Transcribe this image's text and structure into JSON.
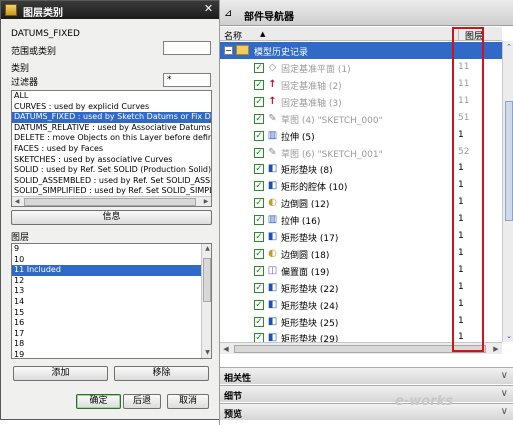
{
  "dialog": {
    "title": "图层类别",
    "close_glyph": "✕",
    "selected_category": "DATUMS_FIXED",
    "range_label": "范围或类别",
    "range_value": "",
    "category_label": "类别",
    "filter_label": "过滤器",
    "filter_value": "*",
    "category_list": [
      "ALL",
      "CURVES : used by explicid Curves",
      "DATUMS_FIXED : used by Sketch Datums or Fix Datums",
      "DATUMS_RELATIVE : used by Associative Datums",
      "DELETE : move Objects on this Layer before definitiv",
      "FACES : used by Faces",
      "SKETCHES : used by associative Curves",
      "SOLID : used by Ref. Set SOLID (Production Solid)",
      "SOLID_ASSEMBLED : used by Ref. Set SOLID_ASSEMBLED",
      "SOLID_SIMPLIFIED : used by Ref. Set SOLID_SIMPLIFIED"
    ],
    "selected_category_index": 2,
    "info_button": "信息",
    "layer_label": "图层",
    "layer_list": [
      "9",
      "10",
      "11 Included",
      "12",
      "13",
      "14",
      "15",
      "16",
      "17",
      "18",
      "19"
    ],
    "selected_layer_index": 2,
    "add_button": "添加",
    "remove_button": "移除",
    "ok_button": "确定",
    "back_button": "后退",
    "cancel_button": "取消"
  },
  "navigator": {
    "pin_glyph": "⊿",
    "title": "部件导航器",
    "col_name": "名称",
    "sort_glyph": "▲",
    "col_layer": "图层",
    "root_label": "模型历史记录",
    "rows": [
      {
        "name": "固定基准平面 (1)",
        "layer": "11",
        "icon": "plane",
        "glyph": "◇",
        "dim": true
      },
      {
        "name": "固定基准轴 (2)",
        "layer": "11",
        "icon": "axis",
        "glyph": "↑",
        "dim": true
      },
      {
        "name": "固定基准轴 (3)",
        "layer": "11",
        "icon": "axis",
        "glyph": "↑",
        "dim": true
      },
      {
        "name": "草图 (4) \"SKETCH_000\"",
        "layer": "51",
        "icon": "sketch",
        "glyph": "✎",
        "dim": true
      },
      {
        "name": "拉伸 (5)",
        "layer": "1",
        "icon": "extrude",
        "glyph": "▥",
        "dim": false
      },
      {
        "name": "草图 (6) \"SKETCH_001\"",
        "layer": "52",
        "icon": "sketch",
        "glyph": "✎",
        "dim": true
      },
      {
        "name": "矩形垫块 (8)",
        "layer": "1",
        "icon": "block",
        "glyph": "◧",
        "dim": false
      },
      {
        "name": "矩形的腔体 (10)",
        "layer": "1",
        "icon": "block",
        "glyph": "◧",
        "dim": false
      },
      {
        "name": "边倒圆 (12)",
        "layer": "1",
        "icon": "round",
        "glyph": "◐",
        "dim": false
      },
      {
        "name": "拉伸 (16)",
        "layer": "1",
        "icon": "extrude",
        "glyph": "▥",
        "dim": false
      },
      {
        "name": "矩形垫块 (17)",
        "layer": "1",
        "icon": "block",
        "glyph": "◧",
        "dim": false
      },
      {
        "name": "边倒圆 (18)",
        "layer": "1",
        "icon": "round",
        "glyph": "◐",
        "dim": false
      },
      {
        "name": "偏置面 (19)",
        "layer": "1",
        "icon": "offset",
        "glyph": "◫",
        "dim": false
      },
      {
        "name": "矩形垫块 (22)",
        "layer": "1",
        "icon": "block",
        "glyph": "◧",
        "dim": false
      },
      {
        "name": "矩形垫块 (24)",
        "layer": "1",
        "icon": "block",
        "glyph": "◧",
        "dim": false
      },
      {
        "name": "矩形垫块 (25)",
        "layer": "1",
        "icon": "block",
        "glyph": "◧",
        "dim": false
      },
      {
        "name": "矩形垫块 (29)",
        "layer": "1",
        "icon": "block",
        "glyph": "◧",
        "dim": false
      }
    ],
    "sections": [
      {
        "title": "相关性",
        "chev": "∨"
      },
      {
        "title": "细节",
        "chev": "∨"
      },
      {
        "title": "预览",
        "chev": "∨"
      }
    ],
    "highlight_color": "#d0121b",
    "selection_color": "#3169c6",
    "watermark": "e-works"
  }
}
